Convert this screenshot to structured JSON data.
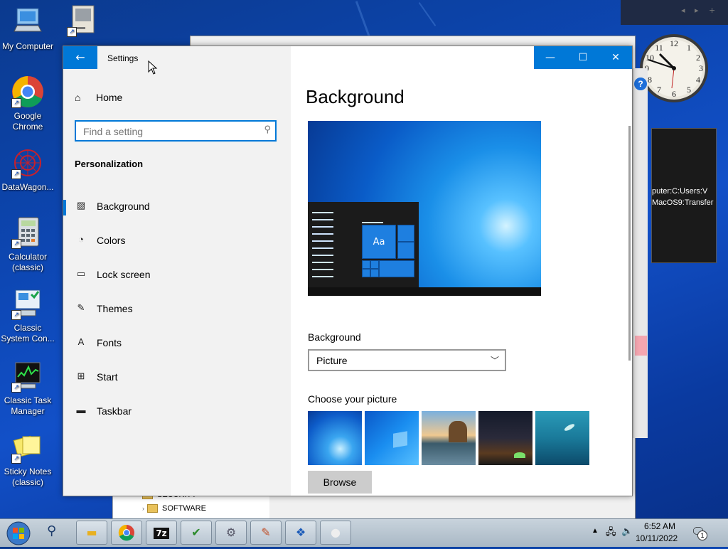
{
  "desktop_icons": [
    {
      "label": "My Computer"
    },
    {
      "label": ""
    },
    {
      "label": "Google Chrome"
    },
    {
      "label": "DataWagon..."
    },
    {
      "label": "Calculator (classic)"
    },
    {
      "label": "Classic System Con..."
    },
    {
      "label": "Classic Task Manager"
    },
    {
      "label": "Sticky Notes (classic)"
    }
  ],
  "background_app": {
    "path_lines": [
      "puter:C:Users:V",
      "MacOS9:Transfer"
    ],
    "tree_items": [
      "SECURITY",
      "SOFTWARE"
    ],
    "help_label": "?"
  },
  "settings": {
    "title": "Settings",
    "back_icon": "back-arrow-icon",
    "home_label": "Home",
    "search_placeholder": "Find a setting",
    "section": "Personalization",
    "nav": [
      {
        "label": "Background",
        "icon": "picture-icon",
        "active": true
      },
      {
        "label": "Colors",
        "icon": "palette-icon"
      },
      {
        "label": "Lock screen",
        "icon": "lock-screen-icon"
      },
      {
        "label": "Themes",
        "icon": "brush-icon"
      },
      {
        "label": "Fonts",
        "icon": "fonts-icon"
      },
      {
        "label": "Start",
        "icon": "start-icon"
      },
      {
        "label": "Taskbar",
        "icon": "taskbar-icon"
      }
    ],
    "main": {
      "title": "Background",
      "preview_tile_text": "Aa",
      "background_label": "Background",
      "background_value": "Picture",
      "choose_label": "Choose your picture",
      "browse_label": "Browse"
    }
  },
  "taskbar": {
    "time": "6:52 AM",
    "date": "10/11/2022",
    "notification_count": "1",
    "apps": [
      "file-explorer-icon",
      "chrome-icon",
      "7zip-icon",
      "control-panel-icon",
      "settings-gear-icon",
      "paint-icon",
      "virtualbox-icon",
      "blank-app-icon"
    ]
  },
  "colors": {
    "accent": "#0078d7",
    "sidebar_bg": "#f2f2f2"
  }
}
